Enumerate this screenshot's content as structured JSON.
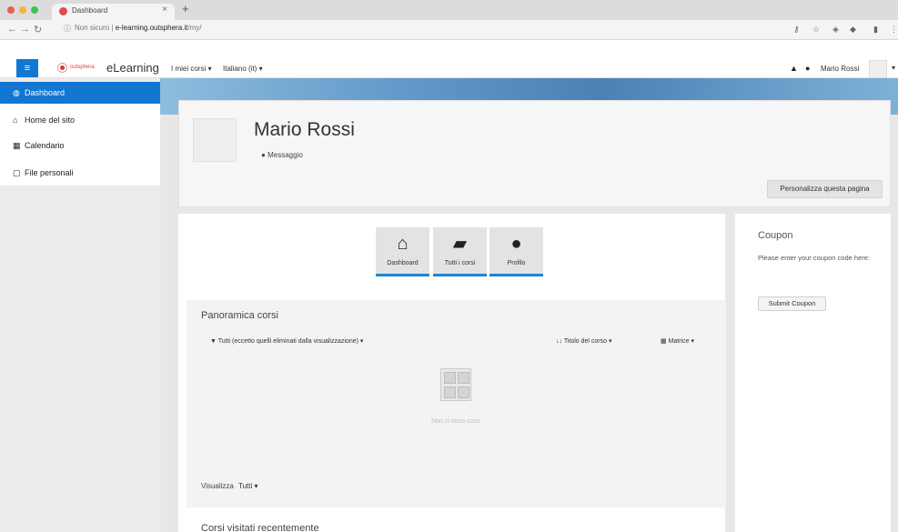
{
  "browser": {
    "tab_title": "Dashboard",
    "tab_close": "×",
    "new_tab": "+",
    "not_secure": "Non sicuro",
    "url_host": "e-learning.outsphera.it",
    "url_path": "/my/",
    "colors": {
      "traffic_red": "#f25b52",
      "traffic_yellow": "#f5b53a",
      "traffic_green": "#43c04d"
    }
  },
  "navbar": {
    "menu_icon": "≡",
    "logo_small_text": "outsphera",
    "brand": "eLearning",
    "links": [
      {
        "label": "I miei corsi ▾"
      },
      {
        "label": "Italiano (it) ▾"
      }
    ],
    "username": "Mario Rossi",
    "caret": "▾"
  },
  "sidebar": {
    "items": [
      {
        "label": "Dashboard",
        "icon": "dashboard-icon",
        "glyph": "◍"
      },
      {
        "label": "Home del sito",
        "icon": "home-icon",
        "glyph": "⌂"
      },
      {
        "label": "Calendario",
        "icon": "calendar-icon",
        "glyph": "▦"
      },
      {
        "label": "File personali",
        "icon": "file-icon",
        "glyph": "▢"
      }
    ]
  },
  "header": {
    "name": "Mario Rossi",
    "message_link": "Messaggio",
    "customise_button": "Personalizza questa pagina"
  },
  "quick_buttons": [
    {
      "label": "Dashboard",
      "icon": "home-icon",
      "glyph": "⌂"
    },
    {
      "label": "Tutti i corsi",
      "icon": "book-icon",
      "glyph": "▰"
    },
    {
      "label": "Profilo",
      "icon": "user-icon",
      "glyph": "●"
    }
  ],
  "overview": {
    "title": "Panoramica corsi",
    "filter": "▼ Tutti (eccetto quelli eliminati dalla visualizzazione) ▾",
    "sort": "↓↓ Titolo del corso ▾",
    "view": "▦ Matrice ▾",
    "empty_text": "Non ci sono corsi",
    "show_label": "Visualizza",
    "show_value": "Tutti ▾"
  },
  "recent": {
    "title": "Corsi visitati recentemente"
  },
  "coupon": {
    "title": "Coupon",
    "text": "Please enter your coupon code here:",
    "button": "Submit Coupon"
  },
  "accent_color": "#1177d1"
}
